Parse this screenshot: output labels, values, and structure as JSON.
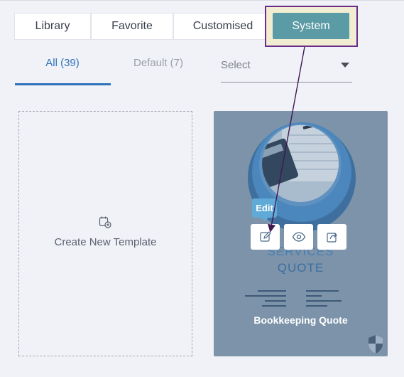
{
  "tabs": {
    "library": "Library",
    "favorite": "Favorite",
    "customised": "Customised",
    "system": "System"
  },
  "subtabs": {
    "all": "All (39)",
    "default": "Default (7)"
  },
  "filter": {
    "select_placeholder": "Select"
  },
  "create_card": {
    "label": "Create New Template"
  },
  "template_card": {
    "name": "Bookkeeping Quote",
    "heading_line1": "SERVICES",
    "heading_line2": "QUOTE",
    "tooltip": "Edit"
  },
  "colors": {
    "accent": "#2d72b8",
    "system_tab": "#5b9ba6",
    "highlight_border": "#6a2b8c",
    "card_overlay": "#7c93a9",
    "tooltip": "#5faad6"
  }
}
